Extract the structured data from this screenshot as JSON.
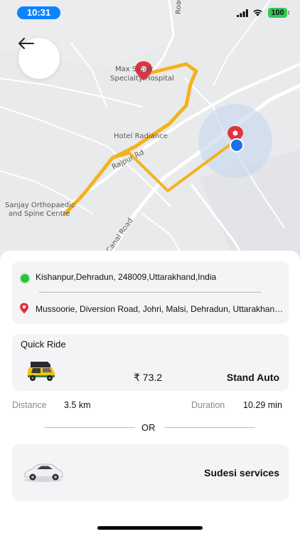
{
  "status_bar": {
    "time": "10:31",
    "battery": "100",
    "icons": [
      "signal-icon",
      "wifi-icon",
      "battery-icon"
    ]
  },
  "map": {
    "labels": {
      "hospital_line1": "Max Super",
      "hospital_line2": "Specialty Hospital",
      "hotel": "Hotel Radiance",
      "ortho_line1": "Sanjay Orthopaedic",
      "ortho_line2": "and Spine Centre",
      "road_rajpur": "Rajpur Rd",
      "road_canal": "Canal Road",
      "road_top": "Road"
    },
    "route_color": "#f4b21f",
    "pin_color": "#e2323e",
    "location_color": "#1a73e8",
    "back_icon": "arrow-left-icon"
  },
  "trip": {
    "pickup": "Kishanpur,Dehradun, 248009,Uttarakhand,India",
    "drop": "Mussoorie, Diversion Road, Johri, Malsi, Dehradun, Uttarakhand, India"
  },
  "quick_ride": {
    "title": "Quick Ride",
    "icon": "auto-rickshaw-icon",
    "fare": "₹ 73.2",
    "vehicle": "Stand Auto"
  },
  "stats": {
    "distance_label": "Distance",
    "distance_value": "3.5 km",
    "duration_label": "Duration",
    "duration_value": "10.29 min"
  },
  "separator": "OR",
  "service": {
    "icon": "car-icon",
    "name": "Sudesi services"
  }
}
